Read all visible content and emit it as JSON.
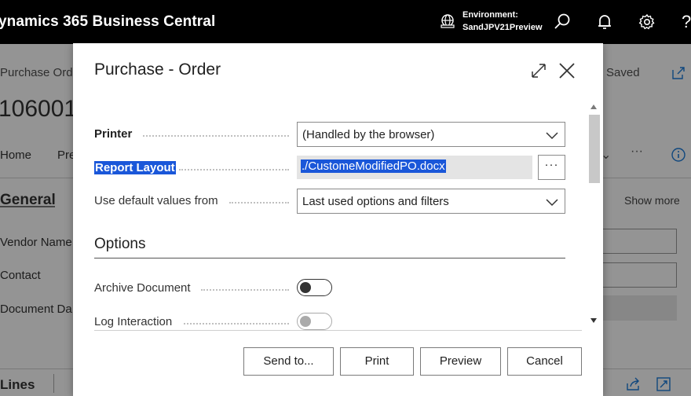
{
  "appbar": {
    "brand": "ynamics 365 Business Central",
    "env_label": "Environment:",
    "env_name": "SandJPV21Preview",
    "icons": [
      "environment-icon",
      "search-icon",
      "bell-icon",
      "gear-icon",
      "help-icon"
    ],
    "help_glyph": "?"
  },
  "background": {
    "page_title": "Purchase Ord",
    "doc_no": "106001",
    "saved": "Saved",
    "tab_home": "Home",
    "tab_pre": "Pre",
    "section_general": "General",
    "show_more": "Show more",
    "vendor_name": "Vendor Name",
    "contact": "Contact",
    "document_date": "Document Da",
    "lines": "Lines"
  },
  "dialog": {
    "title": "Purchase - Order",
    "fields": {
      "printer": {
        "label": "Printer",
        "value": "(Handled by the browser)"
      },
      "report_layout": {
        "label": "Report Layout",
        "value": "./CustomeModifiedPO.docx",
        "assist": "···"
      },
      "use_default": {
        "label": "Use default values from",
        "value": "Last used options and filters"
      }
    },
    "options": {
      "heading": "Options",
      "archive": {
        "label": "Archive Document",
        "on": false
      },
      "log": {
        "label": "Log Interaction",
        "on": false
      }
    },
    "buttons": {
      "send_to": "Send to...",
      "print": "Print",
      "preview": "Preview",
      "cancel": "Cancel"
    }
  },
  "colors": {
    "appbar_bg": "#000000",
    "selection": "#1a57d9",
    "overlay": "rgba(0,0,0,0.42)"
  }
}
